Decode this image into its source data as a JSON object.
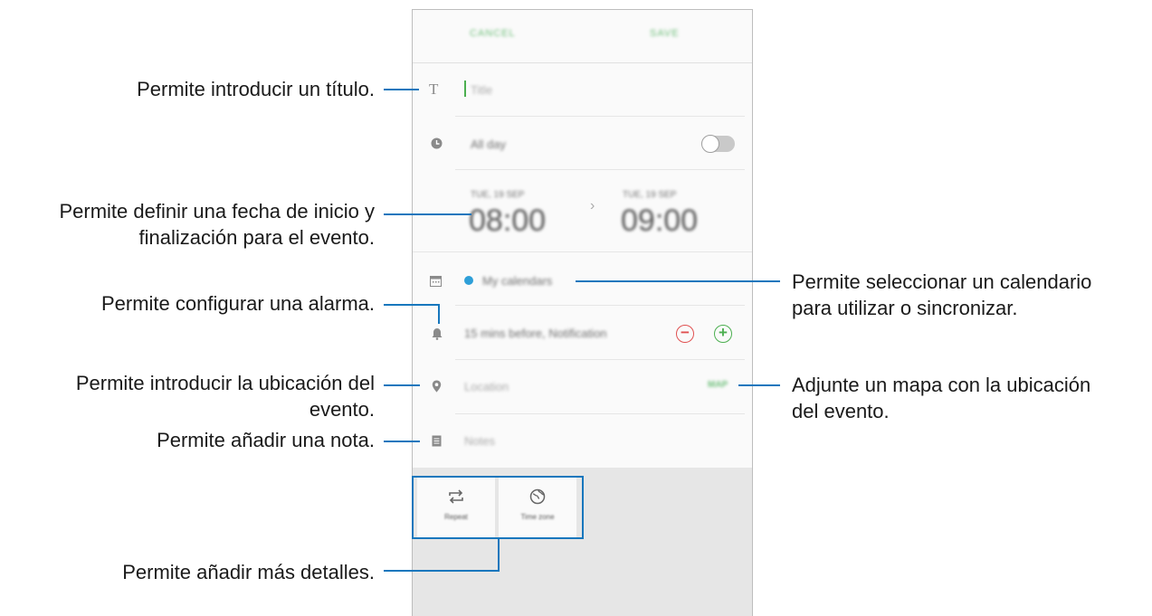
{
  "topbar": {
    "cancel": "CANCEL",
    "save": "SAVE"
  },
  "event": {
    "title_placeholder": "Title",
    "all_day_label": "All day",
    "start_date": "TUE, 19 SEP",
    "start_time": "08:00",
    "end_date": "TUE, 19 SEP",
    "end_time": "09:00",
    "arrow": "›",
    "calendar_label": "My calendars",
    "reminder_label": "15 mins before, Notification",
    "location_placeholder": "Location",
    "map_button": "MAP",
    "notes_placeholder": "Notes"
  },
  "details": {
    "repeat": "Repeat",
    "time_zone": "Time zone"
  },
  "callouts": {
    "title": "Permite introducir un título.",
    "dates_line1": "Permite definir una fecha de inicio y",
    "dates_line2": "finalización para el evento.",
    "alarm": "Permite configurar una alarma.",
    "location_line1": "Permite introducir la ubicación del",
    "location_line2": "evento.",
    "note": "Permite añadir una nota.",
    "more": "Permite añadir más detalles.",
    "calendar_line1": "Permite seleccionar un calendario",
    "calendar_line2": "para utilizar o sincronizar.",
    "map_line1": "Adjunte un mapa con la ubicación",
    "map_line2": "del evento."
  },
  "colors": {
    "accent_line": "#1777bd",
    "save_green": "#6fbf7b",
    "calendar_dot": "#2e9fd8",
    "minus_red": "#e05050",
    "plus_green": "#4caf50"
  }
}
